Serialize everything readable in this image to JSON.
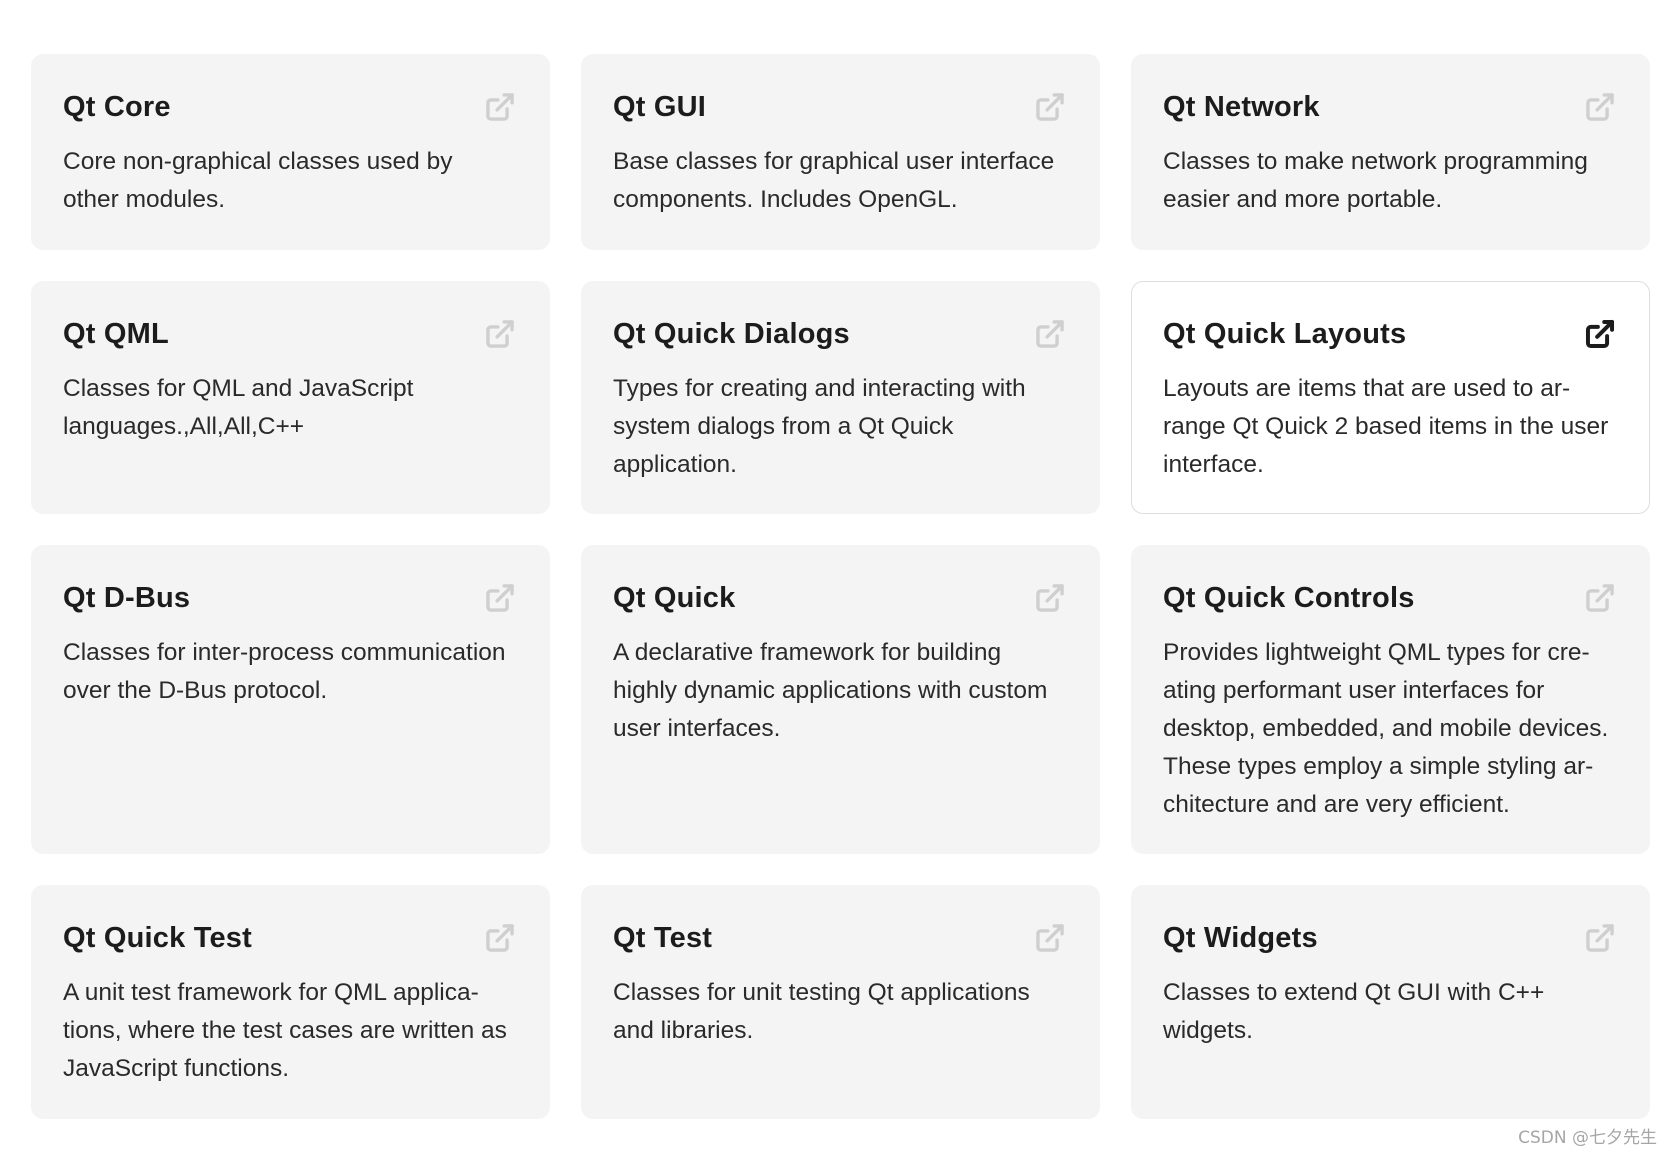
{
  "cards": [
    {
      "title": "Qt Core",
      "description": "Core non-graphical classes used by other modules.",
      "icon": "external-link-icon"
    },
    {
      "title": "Qt GUI",
      "description": "Base classes for graphical user interface components. Includes OpenGL.",
      "icon": "external-link-icon"
    },
    {
      "title": "Qt Network",
      "description": "Classes to make network programming easier and more portable.",
      "icon": "external-link-icon"
    },
    {
      "title": "Qt QML",
      "description": "Classes for QML and JavaScript languages.,All,All,C++",
      "icon": "external-link-icon"
    },
    {
      "title": "Qt Quick Dialogs",
      "description": "Types for creating and interacting with system dialogs from a Qt Quick application.",
      "icon": "external-link-icon"
    },
    {
      "title": "Qt Quick Layouts",
      "description": "Layouts are items that are used to ar­range Qt Quick 2 based items in the user interface.",
      "icon": "external-link-icon"
    },
    {
      "title": "Qt D-Bus",
      "description": "Classes for inter-process communication over the D-Bus protocol.",
      "icon": "external-link-icon"
    },
    {
      "title": "Qt Quick",
      "description": "A declarative framework for building highly dynamic applications with custom user interfaces.",
      "icon": "external-link-icon"
    },
    {
      "title": "Qt Quick Controls",
      "description": "Provides lightweight QML types for cre­ating performant user interfaces for desktop, embedded, and mobile devices. These types employ a simple styling ar­chitecture and are very efficient.",
      "icon": "external-link-icon"
    },
    {
      "title": "Qt Quick Test",
      "description": "A unit test framework for QML applica­tions, where the test cases are written as JavaScript functions.",
      "icon": "external-link-icon"
    },
    {
      "title": "Qt Test",
      "description": "Classes for unit testing Qt applications and libraries.",
      "icon": "external-link-icon"
    },
    {
      "title": "Qt Widgets",
      "description": "Classes to extend Qt GUI with C++ widgets.",
      "icon": "external-link-icon"
    }
  ],
  "active_card": "Qt Quick Layouts",
  "watermark": "CSDN @七夕先生",
  "colors": {
    "card_background": "#f4f4f4",
    "card_active_background": "#ffffff",
    "card_active_border": "#dedede",
    "icon_muted": "#cfcfcf",
    "icon_active": "#1c1c1c",
    "text": "#1c1c1c"
  }
}
